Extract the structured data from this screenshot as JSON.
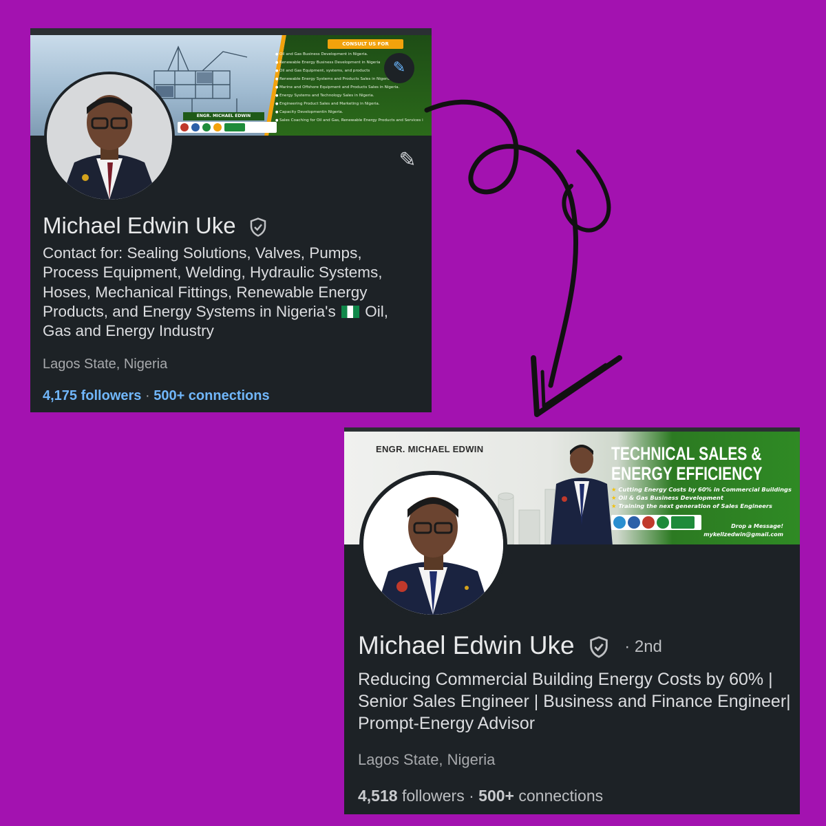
{
  "old_profile": {
    "banner": {
      "consult_header": "CONSULT US FOR",
      "consult_items": [
        "Oil and Gas Business Development in Nigeria.",
        "Renewable Energy Business Development in Nigeria",
        "Oil and Gas Equipment, systems, and products",
        "Renewable Energy Systems and Products Sales in Nigeria",
        "Marine and Offshore Equipment and Products Sales in Nigeria.",
        "Energy Systems and Technology Sales in Nigeria.",
        "Engineering Product Sales and Marketing in Nigeria.",
        "Capacity Developmentin Nigeria.",
        "Sales Coaching for Oil and Gas, Renewable Energy Products and Services in Nigeria"
      ],
      "engr_tag": "ENGR. MICHAEL EDWIN"
    },
    "name": "Michael Edwin Uke",
    "headline_a": "Contact for: Sealing Solutions, Valves, Pumps, Process Equipment, Welding, Hydraulic Systems, Hoses, Mechanical Fittings, Renewable Energy Products, and Energy Systems in Nigeria's",
    "headline_b": "Oil, Gas and Energy Industry",
    "location": "Lagos State, Nigeria",
    "followers": "4,175 followers",
    "separator": "·",
    "connections": "500+ connections"
  },
  "new_profile": {
    "banner": {
      "engr_tag": "ENGR. MICHAEL EDWIN",
      "title_line1": "TECHNICAL SALES &",
      "title_line2": "ENERGY EFFICIENCY",
      "bullets": [
        "Cutting Energy Costs by 60% in Commercial Buildings",
        "Oil & Gas Business Development",
        "Training the next generation of Sales Engineers"
      ],
      "drop_message": "Drop a Message!",
      "email": "mykellzedwin@gmail.com"
    },
    "name": "Michael Edwin Uke",
    "degree": "· 2nd",
    "headline": "Reducing Commercial Building Energy Costs by 60% | Senior Sales Engineer | Business and Finance Engineer| Prompt-Energy Advisor",
    "location": "Lagos State, Nigeria",
    "followers_count": "4,518",
    "followers_label": "followers",
    "separator": "·",
    "connections_count": "500+",
    "connections_label": "connections"
  },
  "colors": {
    "background": "#a312b0",
    "card": "#1d2226",
    "link_blue": "#71b7fb",
    "banner_green": "#2c7a22",
    "accent_orange": "#f2a20c"
  },
  "icons": [
    "verified-shield-icon",
    "edit-pencil-icon",
    "edit-banner-icon",
    "arrow-icon"
  ]
}
